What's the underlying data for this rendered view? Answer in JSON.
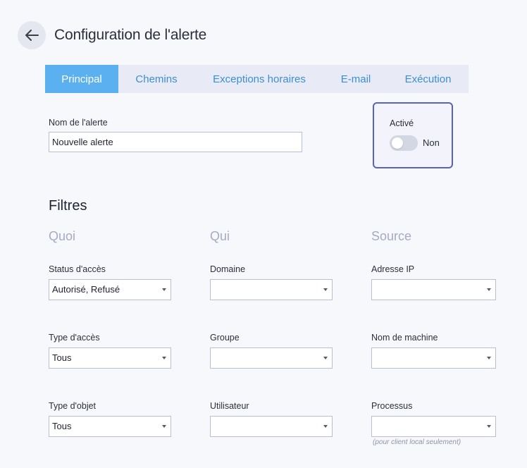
{
  "header": {
    "title": "Configuration de l'alerte",
    "back_icon": "arrow-left-icon"
  },
  "tabs": [
    {
      "label": "Principal",
      "active": true
    },
    {
      "label": "Chemins",
      "active": false
    },
    {
      "label": "Exceptions horaires",
      "active": false
    },
    {
      "label": "E-mail",
      "active": false
    },
    {
      "label": "Exécution",
      "active": false
    }
  ],
  "name_field": {
    "label": "Nom de l'alerte",
    "value": "Nouvelle alerte"
  },
  "activation": {
    "label": "Activé",
    "state_text": "Non",
    "enabled": false
  },
  "filters": {
    "title": "Filtres",
    "columns": [
      {
        "title": "Quoi",
        "fields": [
          {
            "label": "Status d'accès",
            "value": "Autorisé, Refusé"
          },
          {
            "label": "Type d'accès",
            "value": "Tous"
          },
          {
            "label": "Type d'objet",
            "value": "Tous"
          }
        ]
      },
      {
        "title": "Qui",
        "fields": [
          {
            "label": "Domaine",
            "value": ""
          },
          {
            "label": "Groupe",
            "value": ""
          },
          {
            "label": "Utilisateur",
            "value": ""
          }
        ]
      },
      {
        "title": "Source",
        "fields": [
          {
            "label": "Adresse IP",
            "value": ""
          },
          {
            "label": "Nom de machine",
            "value": ""
          },
          {
            "label": "Processus",
            "value": ""
          }
        ]
      }
    ],
    "process_note": "(pour client local seulement)"
  },
  "colors": {
    "accent": "#5bb1ef",
    "tab_text": "#3b8fd6",
    "tab_bar": "#e8eaf5",
    "active_border": "#5961c4",
    "muted": "#a6aac4"
  }
}
